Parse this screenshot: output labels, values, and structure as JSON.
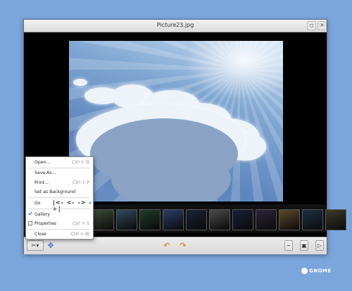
{
  "window": {
    "title": "Picture23.jpg",
    "maximize_icon": "maximize-icon",
    "close_icon": "close-icon"
  },
  "filmstrip": {
    "thumbnails": [
      {
        "color": "#3d4a3a"
      },
      {
        "color": "#2f4a5a"
      },
      {
        "color": "#1f3b2a"
      },
      {
        "color": "#2a3c6a"
      },
      {
        "color": "#1c2233"
      },
      {
        "color": "#4a4a4a"
      },
      {
        "color": "#1a1e35"
      },
      {
        "color": "#2b2638"
      },
      {
        "color": "#5a4a2a"
      },
      {
        "color": "#1f2f44"
      },
      {
        "color": "#3a3a2a"
      }
    ],
    "next_icon": "arrow-right-icon"
  },
  "toolbar": {
    "tools_icon": "tools-icon",
    "tools_dropdown_icon": "chevron-down-icon",
    "fit_icon": "fit-view-icon",
    "rotate_left_icon": "rotate-left-icon",
    "rotate_right_icon": "rotate-right-icon",
    "zoom_icon": "zoom-icon",
    "fullscreen_icon": "fullscreen-icon",
    "slideshow_icon": "slideshow-icon"
  },
  "menu": {
    "items": [
      {
        "label": "Open...",
        "shortcut": "Ctrl + O"
      },
      {
        "label": "Save As...",
        "shortcut": ""
      },
      {
        "label": "Print...",
        "shortcut": "Ctrl + P"
      },
      {
        "label": "Set as Background",
        "shortcut": ""
      },
      {
        "label": "Go",
        "shortcut": ""
      },
      {
        "label": "Gallery",
        "shortcut": "",
        "checked": true
      },
      {
        "label": "Properties",
        "shortcut": "Ctrl + S",
        "checked": false
      },
      {
        "label": "Close",
        "shortcut": "Ctrl + W"
      }
    ],
    "go_icons": "|<- <- -> ->|"
  },
  "branding": {
    "gnome_label": "GNOME"
  }
}
